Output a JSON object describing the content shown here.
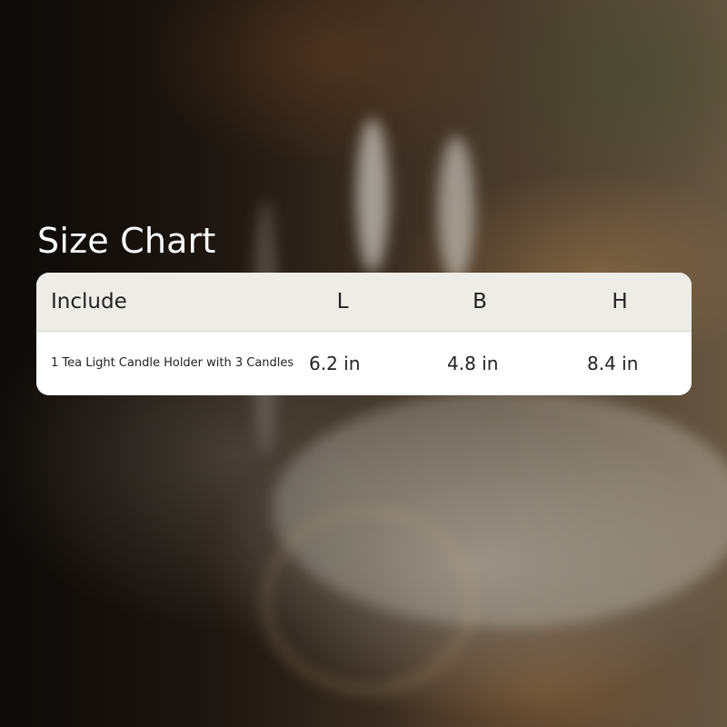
{
  "title": "Size Chart",
  "table": {
    "headers": [
      "Include",
      "L",
      "B",
      "H"
    ],
    "rows": [
      [
        "1 Tea Light Candle Holder with 3 Candles",
        "6.2 in",
        "4.8 in",
        "8.4 in"
      ]
    ]
  },
  "colors": {
    "title_text": "#ffffff",
    "header_bg": "#eeece6",
    "body_bg": "#ffffff",
    "cell_text": "#222222"
  }
}
